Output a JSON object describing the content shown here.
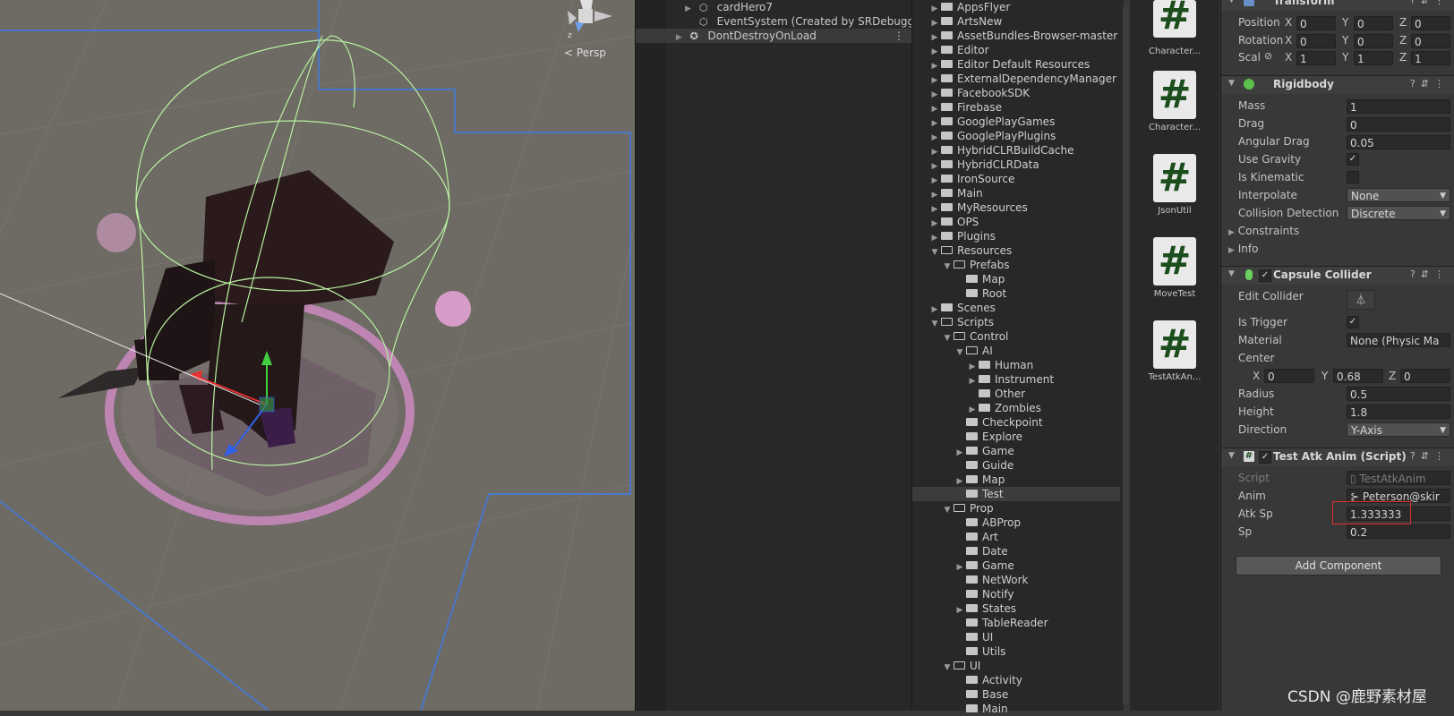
{
  "scene": {
    "persp_label": "Persp",
    "gizmo_axis_label": "z"
  },
  "hierarchy": {
    "rows": [
      {
        "label": "cardHero7",
        "arrow": "▶"
      },
      {
        "label": "EventSystem (Created by SRDebugger, d",
        "arrow": ""
      },
      {
        "label": "DontDestroyOnLoad",
        "arrow": "▶"
      }
    ],
    "kebab": "⋮"
  },
  "project": {
    "tree": [
      {
        "label": "AppsFlyer",
        "depth": 0,
        "arrow": "▶",
        "open": false
      },
      {
        "label": "ArtsNew",
        "depth": 0,
        "arrow": "▶",
        "open": false
      },
      {
        "label": "AssetBundles-Browser-master",
        "depth": 0,
        "arrow": "▶",
        "open": false
      },
      {
        "label": "Editor",
        "depth": 0,
        "arrow": "▶",
        "open": false
      },
      {
        "label": "Editor Default Resources",
        "depth": 0,
        "arrow": "▶",
        "open": false
      },
      {
        "label": "ExternalDependencyManager",
        "depth": 0,
        "arrow": "▶",
        "open": false
      },
      {
        "label": "FacebookSDK",
        "depth": 0,
        "arrow": "▶",
        "open": false
      },
      {
        "label": "Firebase",
        "depth": 0,
        "arrow": "▶",
        "open": false
      },
      {
        "label": "GooglePlayGames",
        "depth": 0,
        "arrow": "▶",
        "open": false
      },
      {
        "label": "GooglePlayPlugins",
        "depth": 0,
        "arrow": "▶",
        "open": false
      },
      {
        "label": "HybridCLRBuildCache",
        "depth": 0,
        "arrow": "▶",
        "open": false
      },
      {
        "label": "HybridCLRData",
        "depth": 0,
        "arrow": "▶",
        "open": false
      },
      {
        "label": "IronSource",
        "depth": 0,
        "arrow": "▶",
        "open": false
      },
      {
        "label": "Main",
        "depth": 0,
        "arrow": "▶",
        "open": false
      },
      {
        "label": "MyResources",
        "depth": 0,
        "arrow": "▶",
        "open": false
      },
      {
        "label": "OPS",
        "depth": 0,
        "arrow": "▶",
        "open": false
      },
      {
        "label": "Plugins",
        "depth": 0,
        "arrow": "▶",
        "open": false
      },
      {
        "label": "Resources",
        "depth": 0,
        "arrow": "▼",
        "open": true
      },
      {
        "label": "Prefabs",
        "depth": 1,
        "arrow": "▼",
        "open": true
      },
      {
        "label": "Map",
        "depth": 2,
        "arrow": "",
        "open": false
      },
      {
        "label": "Root",
        "depth": 2,
        "arrow": "",
        "open": false
      },
      {
        "label": "Scenes",
        "depth": 0,
        "arrow": "▶",
        "open": false
      },
      {
        "label": "Scripts",
        "depth": 0,
        "arrow": "▼",
        "open": true
      },
      {
        "label": "Control",
        "depth": 1,
        "arrow": "▼",
        "open": true
      },
      {
        "label": "AI",
        "depth": 2,
        "arrow": "▼",
        "open": true
      },
      {
        "label": "Human",
        "depth": 3,
        "arrow": "▶",
        "open": false
      },
      {
        "label": "Instrument",
        "depth": 3,
        "arrow": "▶",
        "open": false
      },
      {
        "label": "Other",
        "depth": 3,
        "arrow": "",
        "open": false
      },
      {
        "label": "Zombies",
        "depth": 3,
        "arrow": "▶",
        "open": false
      },
      {
        "label": "Checkpoint",
        "depth": 2,
        "arrow": "",
        "open": false
      },
      {
        "label": "Explore",
        "depth": 2,
        "arrow": "",
        "open": false
      },
      {
        "label": "Game",
        "depth": 2,
        "arrow": "▶",
        "open": false
      },
      {
        "label": "Guide",
        "depth": 2,
        "arrow": "",
        "open": false
      },
      {
        "label": "Map",
        "depth": 2,
        "arrow": "▶",
        "open": false
      },
      {
        "label": "Test",
        "depth": 2,
        "arrow": "",
        "open": false,
        "selected": true
      },
      {
        "label": "Prop",
        "depth": 1,
        "arrow": "▼",
        "open": true
      },
      {
        "label": "ABProp",
        "depth": 2,
        "arrow": "",
        "open": false
      },
      {
        "label": "Art",
        "depth": 2,
        "arrow": "",
        "open": false
      },
      {
        "label": "Date",
        "depth": 2,
        "arrow": "",
        "open": false
      },
      {
        "label": "Game",
        "depth": 2,
        "arrow": "▶",
        "open": false
      },
      {
        "label": "NetWork",
        "depth": 2,
        "arrow": "",
        "open": false
      },
      {
        "label": "Notify",
        "depth": 2,
        "arrow": "",
        "open": false
      },
      {
        "label": "States",
        "depth": 2,
        "arrow": "▶",
        "open": false
      },
      {
        "label": "TableReader",
        "depth": 2,
        "arrow": "",
        "open": false
      },
      {
        "label": "UI",
        "depth": 2,
        "arrow": "",
        "open": false
      },
      {
        "label": "Utils",
        "depth": 2,
        "arrow": "",
        "open": false
      },
      {
        "label": "UI",
        "depth": 1,
        "arrow": "▼",
        "open": true
      },
      {
        "label": "Activity",
        "depth": 2,
        "arrow": "",
        "open": false
      },
      {
        "label": "Base",
        "depth": 2,
        "arrow": "",
        "open": false
      },
      {
        "label": "Main",
        "depth": 2,
        "arrow": "",
        "open": false
      }
    ]
  },
  "assets": [
    {
      "label": "Character...",
      "glyph": "#"
    },
    {
      "label": "Character...",
      "glyph": "#"
    },
    {
      "label": "JsonUtil",
      "glyph": "#"
    },
    {
      "label": "MoveTest",
      "glyph": "#"
    },
    {
      "label": "TestAtkAn...",
      "glyph": "#"
    }
  ],
  "inspector": {
    "transform": {
      "title": "Transform",
      "position_label": "Position",
      "rotation_label": "Rotation",
      "scale_label": "Scal",
      "axis_x": "X",
      "axis_y": "Y",
      "axis_z": "Z",
      "position": [
        "0",
        "0",
        "0"
      ],
      "rotation": [
        "0",
        "0",
        "0"
      ],
      "scale": [
        "1",
        "1",
        "1"
      ]
    },
    "rigidbody": {
      "title": "Rigidbody",
      "mass_label": "Mass",
      "mass": "1",
      "drag_label": "Drag",
      "drag": "0",
      "angular_drag_label": "Angular Drag",
      "angular_drag": "0.05",
      "use_gravity_label": "Use Gravity",
      "use_gravity_check": "✓",
      "is_kinematic_label": "Is Kinematic",
      "interpolate_label": "Interpolate",
      "interpolate": "None",
      "collision_label": "Collision Detection",
      "collision": "Discrete",
      "constraints_label": "Constraints",
      "info_label": "Info"
    },
    "capsule": {
      "title": "Capsule Collider",
      "enabled_check": "✓",
      "edit_collider_label": "Edit Collider",
      "is_trigger_label": "Is Trigger",
      "is_trigger_check": "✓",
      "material_label": "Material",
      "material": "None (Physic Ma",
      "center_label": "Center",
      "center": [
        "0",
        "0.68",
        "0"
      ],
      "radius_label": "Radius",
      "radius": "0.5",
      "height_label": "Height",
      "height": "1.8",
      "direction_label": "Direction",
      "direction": "Y-Axis"
    },
    "script": {
      "title": "Test Atk Anim (Script)",
      "enabled_check": "✓",
      "script_label": "Script",
      "script": "TestAtkAnim",
      "anim_label": "Anim",
      "anim": "Peterson@skir",
      "atk_sp_label": "Atk Sp",
      "atk_sp": "1.333333",
      "sp_label": "Sp",
      "sp": "0.2"
    },
    "add_component": "Add Component"
  },
  "watermark": "CSDN @鹿野素材屋",
  "colors": {
    "accent_highlight": "#e03030",
    "scene_bg": "#6e6a64",
    "scene_bounds": "#4a78c8",
    "collider": "#b8f0a0",
    "glow": "#e49ad6",
    "script_icon": "#1c4d1c"
  }
}
